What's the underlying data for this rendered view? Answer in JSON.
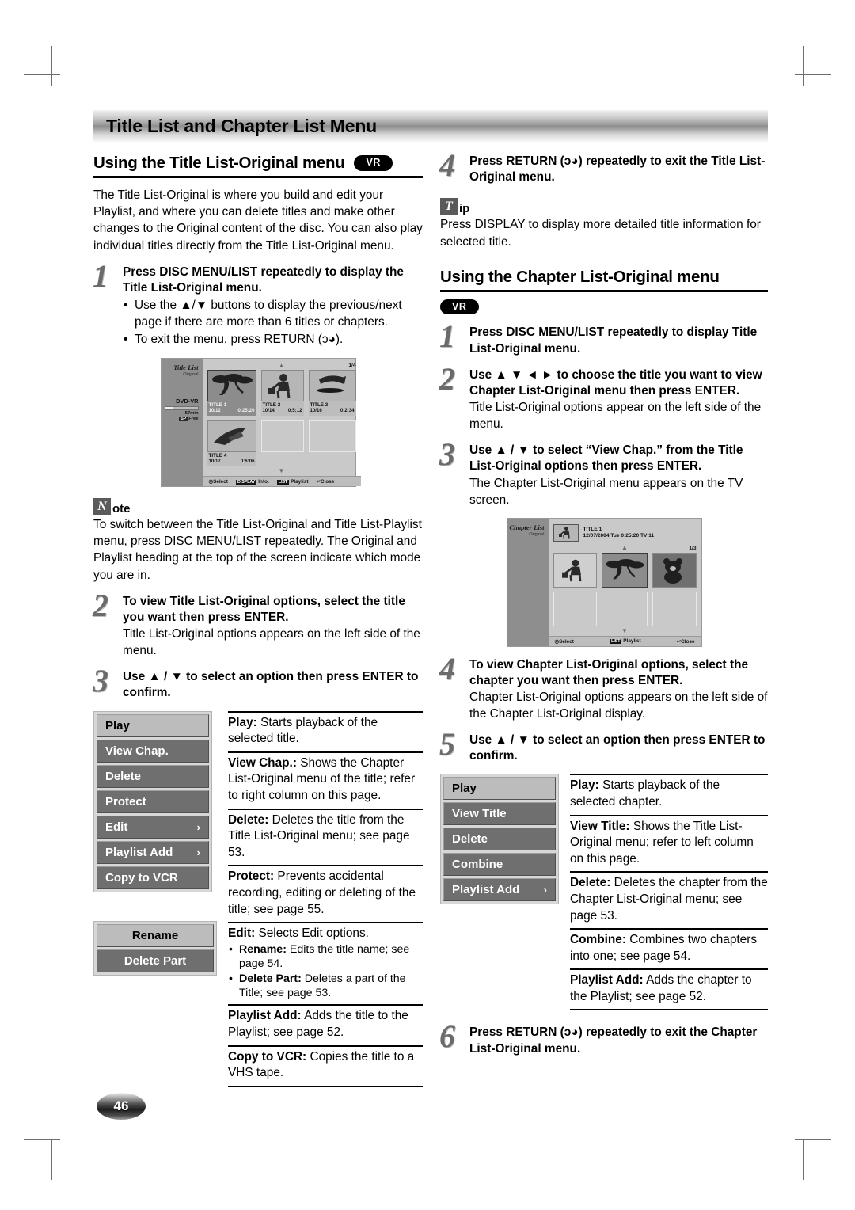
{
  "page": {
    "number": "46",
    "banner_title": "Title List and Chapter List Menu"
  },
  "left_column": {
    "section_title": "Using the Title List-Original menu",
    "section_badge": "VR",
    "intro": "The Title List-Original is where you build and edit your Playlist, and where you can delete titles and make other changes to the Original content of the disc. You can also play individual titles directly from the Title List-Original menu.",
    "step1": {
      "num": "1",
      "heading": "Press DISC MENU/LIST repeatedly to display the Title List-Original menu.",
      "bullets": [
        "Use the ▲/▼ buttons to display the previous/next page if there are more than 6 titles or chapters.",
        "To exit the menu, press RETURN (ↄ◕)."
      ]
    },
    "note": {
      "glyph": "N",
      "word": "ote",
      "text": "To switch between the Title List-Original and Title List-Playlist menu, press DISC MENU/LIST repeatedly. The Original and Playlist heading at the top of the screen indicate which mode you are in."
    },
    "step2": {
      "num": "2",
      "heading": "To view Title List-Original options, select the title you want then press ENTER.",
      "body": "Title List-Original options appears on the left side of the menu."
    },
    "step3": {
      "num": "3",
      "heading": "Use ▲ / ▼ to select an option then press ENTER to confirm."
    },
    "option_menu": [
      {
        "label": "Play",
        "highlight": true,
        "arrow": ""
      },
      {
        "label": "View Chap.",
        "highlight": false,
        "arrow": ""
      },
      {
        "label": "Delete",
        "highlight": false,
        "arrow": ""
      },
      {
        "label": "Protect",
        "highlight": false,
        "arrow": ""
      },
      {
        "label": "Edit",
        "highlight": false,
        "arrow": "›"
      },
      {
        "label": "Playlist Add",
        "highlight": false,
        "arrow": "›"
      },
      {
        "label": "Copy to VCR",
        "highlight": false,
        "arrow": ""
      }
    ],
    "submenu": [
      {
        "label": "Rename",
        "highlight": true,
        "arrow": ""
      },
      {
        "label": "Delete Part",
        "highlight": false,
        "arrow": ""
      }
    ],
    "definitions": [
      {
        "term": "Play:",
        "text": " Starts playback of the selected title.",
        "sub": []
      },
      {
        "term": "View Chap.:",
        "text": " Shows the Chapter List-Original menu of the title; refer to right column on this page.",
        "sub": []
      },
      {
        "term": "Delete:",
        "text": " Deletes the title from the Title List-Original menu; see page 53.",
        "sub": []
      },
      {
        "term": "Protect:",
        "text": " Prevents accidental recording, editing or deleting of the title; see page 55.",
        "sub": []
      },
      {
        "term": "Edit:",
        "text": " Selects Edit options.",
        "sub": [
          {
            "term": "Rename:",
            "text": " Edits the title name; see page 54."
          },
          {
            "term": "Delete Part:",
            "text": " Deletes a part of the Title; see page 53."
          }
        ]
      },
      {
        "term": "Playlist Add:",
        "text": " Adds the title to the Playlist; see page 52.",
        "sub": []
      },
      {
        "term": "Copy to VCR:",
        "text": " Copies the title to a VHS tape.",
        "sub": []
      }
    ]
  },
  "title_list_screen": {
    "side_title": "Title List",
    "side_subtitle": "Original",
    "disc_type": "DVD-VR",
    "remaining": "57min",
    "mode_chip": "SP",
    "free_label": "Free",
    "page_indicator": "1/4",
    "titles": [
      {
        "name": "TITLE 1",
        "date": "10/12",
        "time": "0:25:20",
        "selected": true,
        "art": "trees"
      },
      {
        "name": "TITLE 2",
        "date": "10/14",
        "time": "0:5:12",
        "selected": false,
        "art": "person"
      },
      {
        "name": "TITLE 3",
        "date": "10/16",
        "time": "0:2:34",
        "selected": false,
        "art": "bird"
      },
      {
        "name": "TITLE 4",
        "date": "10/17",
        "time": "0:6:06",
        "selected": false,
        "art": "shuttle"
      }
    ],
    "footer": [
      {
        "chip": "",
        "icon": "⊚",
        "label": "Select"
      },
      {
        "chip": "DISPLAY",
        "icon": "",
        "label": "Info."
      },
      {
        "chip": "LIST",
        "icon": "",
        "label": "Playlist"
      },
      {
        "chip": "",
        "icon": "ↄ",
        "label": "Close"
      }
    ]
  },
  "right_column": {
    "step4_top": {
      "num": "4",
      "heading": "Press RETURN (ↄ◕) repeatedly to exit the Title List-Original menu."
    },
    "tip": {
      "glyph": "T",
      "word": "ip",
      "text": "Press DISPLAY to display more detailed title information for selected title."
    },
    "section_title": "Using the Chapter List-Original menu",
    "section_badge": "VR",
    "step1": {
      "num": "1",
      "heading": "Press DISC MENU/LIST repeatedly to display Title List-Original menu."
    },
    "step2": {
      "num": "2",
      "heading": "Use ▲ ▼ ◄ ► to choose the title you want to view Chapter List-Original menu then press ENTER.",
      "body": "Title List-Original options appear on the left side of the menu."
    },
    "step3": {
      "num": "3",
      "heading": "Use ▲ / ▼ to select “View Chap.” from the Title List-Original options then press ENTER.",
      "body": "The Chapter List-Original menu appears on the TV screen."
    },
    "step4": {
      "num": "4",
      "heading": "To view Chapter List-Original options, select the chapter you want then press ENTER.",
      "body": "Chapter List-Original options appears on the left side of the Chapter List-Original display."
    },
    "step5": {
      "num": "5",
      "heading": "Use ▲ / ▼ to select an option then press ENTER to confirm."
    },
    "step6": {
      "num": "6",
      "heading": "Press RETURN (ↄ◕) repeatedly to exit the Chapter List-Original menu."
    },
    "option_menu": [
      {
        "label": "Play",
        "highlight": true,
        "arrow": ""
      },
      {
        "label": "View Title",
        "highlight": false,
        "arrow": ""
      },
      {
        "label": "Delete",
        "highlight": false,
        "arrow": ""
      },
      {
        "label": "Combine",
        "highlight": false,
        "arrow": ""
      },
      {
        "label": "Playlist Add",
        "highlight": false,
        "arrow": "›"
      }
    ],
    "definitions": [
      {
        "term": "Play:",
        "text": " Starts playback of the selected chapter."
      },
      {
        "term": "View Title:",
        "text": " Shows the Title List-Original menu; refer to left column on this page."
      },
      {
        "term": "Delete:",
        "text": " Deletes the chapter from the Chapter List-Original menu; see page 53."
      },
      {
        "term": "Combine:",
        "text": " Combines two chapters into one; see page 54."
      },
      {
        "term": "Playlist Add:",
        "text": " Adds the chapter to the Playlist; see page 52."
      }
    ]
  },
  "chapter_list_screen": {
    "side_title": "Chapter List",
    "side_subtitle": "Original",
    "header_title": "TITLE 1",
    "header_info": "12/07/2004  Tue 0:25:20   TV 11",
    "page_indicator": "1/3",
    "chapters": [
      {
        "selected": false,
        "art": "person"
      },
      {
        "selected": true,
        "art": "trees"
      },
      {
        "selected": false,
        "art": "bear"
      }
    ],
    "footer": [
      {
        "chip": "",
        "icon": "⊚",
        "label": "Select"
      },
      {
        "chip": "LIST",
        "icon": "",
        "label": "Playlist"
      },
      {
        "chip": "",
        "icon": "ↄ",
        "label": "Close"
      }
    ]
  }
}
